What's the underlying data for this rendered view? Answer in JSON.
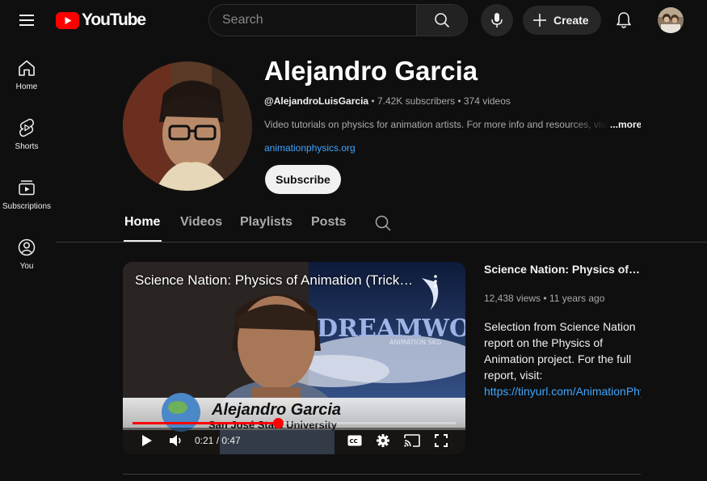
{
  "brand": {
    "logo_text": "YouTube",
    "accent": "#ff0000"
  },
  "search": {
    "placeholder": "Search"
  },
  "header": {
    "create_label": "Create"
  },
  "sidebar": {
    "items": [
      {
        "label": "Home",
        "icon": "home-icon"
      },
      {
        "label": "Shorts",
        "icon": "shorts-icon"
      },
      {
        "label": "Subscriptions",
        "icon": "subscriptions-icon"
      },
      {
        "label": "You",
        "icon": "you-icon"
      }
    ]
  },
  "channel": {
    "name": "Alejandro Garcia",
    "handle": "@AlejandroLuisGarcia",
    "stats": " • 7.42K subscribers • 374 videos",
    "description": "Video tutorials on physics for animation artists. For more info and resources, visit",
    "more_label": "...more",
    "link": "animationphysics.org",
    "subscribe_label": "Subscribe"
  },
  "tabs": [
    {
      "label": "Home",
      "active": true
    },
    {
      "label": "Videos",
      "active": false
    },
    {
      "label": "Playlists",
      "active": false
    },
    {
      "label": "Posts",
      "active": false
    }
  ],
  "featured": {
    "player_title": "Science Nation: Physics of Animation (Trickery)",
    "overlay_name": "Alejandro Garcia",
    "overlay_affiliation": "San José State University",
    "overlay_brand": "DREAMWO",
    "overlay_brand_sub": "ANIMATION SKG",
    "time": "0:21 / 0:47",
    "progress": 0.45,
    "title": "Science Nation: Physics of Animation (Trickery)",
    "meta": "12,438 views • 11 years ago",
    "description": "Selection from Science Nation report on the Physics of Animation project. For the full report, visit:",
    "link": "https://tinyurl.com/AnimationPhysics"
  }
}
